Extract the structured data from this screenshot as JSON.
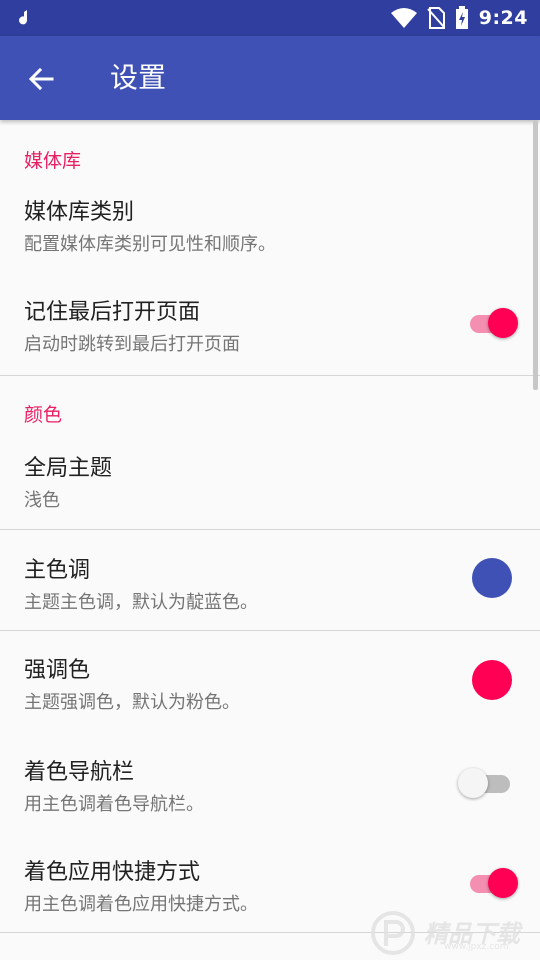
{
  "status_bar": {
    "time": "9:24",
    "icons": [
      "notification-icon",
      "wifi-icon",
      "no-sim-icon",
      "battery-charging-icon"
    ]
  },
  "toolbar": {
    "title": "设置",
    "back_icon": "arrow-back-icon"
  },
  "sections": {
    "library": {
      "header": "媒体库",
      "category": {
        "title": "媒体库类别",
        "summary": "配置媒体库类别可见性和顺序。"
      },
      "remember": {
        "title": "记住最后打开页面",
        "summary": "启动时跳转到最后打开页面",
        "enabled": true
      }
    },
    "colors": {
      "header": "颜色",
      "theme": {
        "title": "全局主题",
        "summary": "浅色"
      },
      "primary": {
        "title": "主色调",
        "summary": "主题主色调，默认为靛蓝色。",
        "color": "#3f51b5"
      },
      "accent": {
        "title": "强调色",
        "summary": "主题强调色，默认为粉色。",
        "color": "#ff0055"
      },
      "navbar": {
        "title": "着色导航栏",
        "summary": "用主色调着色导航栏。",
        "enabled": false
      },
      "shortcuts": {
        "title": "着色应用快捷方式",
        "summary": "用主色调着色应用快捷方式。",
        "enabled": true
      }
    }
  },
  "watermark": {
    "text": "精品下载",
    "url": "www.jpxz.com"
  },
  "colors": {
    "primary": "#3f51b5",
    "primary_dark": "#303f9f",
    "accent": "#e91e63"
  }
}
